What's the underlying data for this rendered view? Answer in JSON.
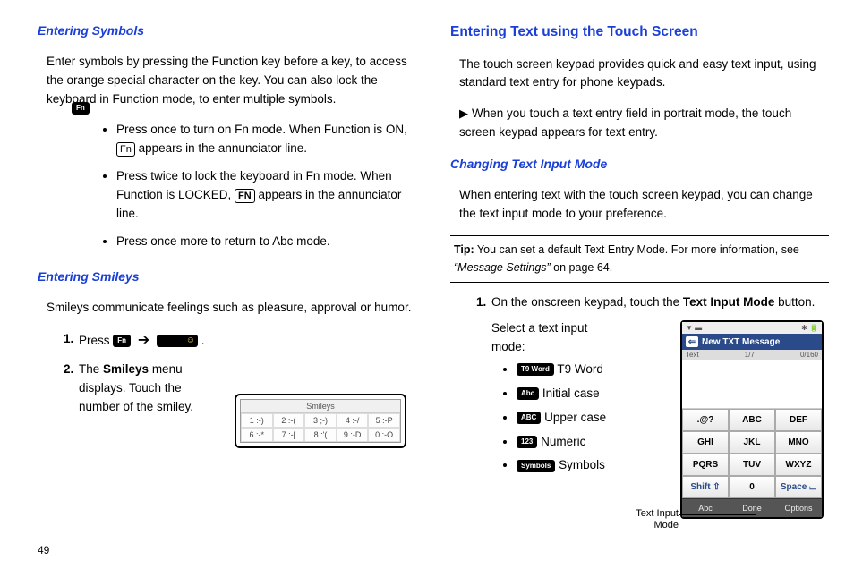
{
  "left": {
    "h1": "Entering Symbols",
    "p1": "Enter symbols by pressing the Function key before a key, to access the orange special character on the key. You can also lock the keyboard in Function mode, to enter multiple symbols.",
    "fn_badge": "Fn",
    "b1a": "Press once to turn on Fn mode. When Function is ON, ",
    "b1_icon": "Fn",
    "b1b": " appears in the annunciator line.",
    "b2a": "Press twice to lock the keyboard in Fn mode. When Function is LOCKED, ",
    "b2_icon": "FN",
    "b2b": " appears in the annunciator line.",
    "b3": "Press once more to return to Abc mode.",
    "h2": "Entering Smileys",
    "p2": "Smileys communicate feelings such as pleasure, approval or humor.",
    "s1a": "Press ",
    "s1_badge": "Fn",
    "s1_arrow": "➔",
    "s1b": " .",
    "s2a": "The ",
    "s2_strong": "Smileys",
    "s2b": " menu displays. Touch the number of the smiley.",
    "smileys_title": "Smileys",
    "sm": [
      "1 :-)",
      "2 :-(",
      "3 ;-)",
      "4 :-/",
      "5 :-P",
      "6 :-*",
      "7 :-[",
      "8 :'(",
      "9 :-D",
      "0 :-O"
    ]
  },
  "right": {
    "h1": "Entering Text using the Touch Screen",
    "p1": "The touch screen keypad provides quick and easy text input, using standard text entry for phone keypads.",
    "p2": "When you touch a text entry field in portrait mode, the touch screen keypad appears for text entry.",
    "h2": "Changing Text Input Mode",
    "p3": "When entering text with the touch screen keypad, you can change the text input mode to your preference.",
    "tip_label": "Tip:",
    "tip_a": " You can set a default Text Entry Mode. For more information, see ",
    "tip_ref": "“Message Settings”",
    "tip_b": " on page 64.",
    "step1a": "On the onscreen keypad, touch the ",
    "step1_strong": "Text Input Mode",
    "step1b": " button.",
    "step1c": "Select a text input mode:",
    "modes": [
      {
        "badge": "T9 Word",
        "label": "T9 Word"
      },
      {
        "badge": "Abc",
        "label": "Initial case"
      },
      {
        "badge": "ABC",
        "label": "Upper case"
      },
      {
        "badge": "123",
        "label": "Numeric"
      },
      {
        "badge": "Symbols",
        "label": "Symbols"
      }
    ],
    "caption1": "Text Input",
    "caption2": "Mode"
  },
  "phone": {
    "status_left": "▼ ▬",
    "status_right": "✱  🔋",
    "title": "New TXT Message",
    "meta_left": "Text",
    "meta_mid": "1/7",
    "meta_right": "0/160",
    "keys": [
      ".@?",
      "ABC",
      "DEF",
      "GHI",
      "JKL",
      "MNO",
      "PQRS",
      "TUV",
      "WXYZ",
      "Shift ⇧",
      "0",
      "Space ⌴"
    ],
    "soft": [
      "Abc",
      "Done",
      "Options"
    ]
  },
  "page_number": "49"
}
